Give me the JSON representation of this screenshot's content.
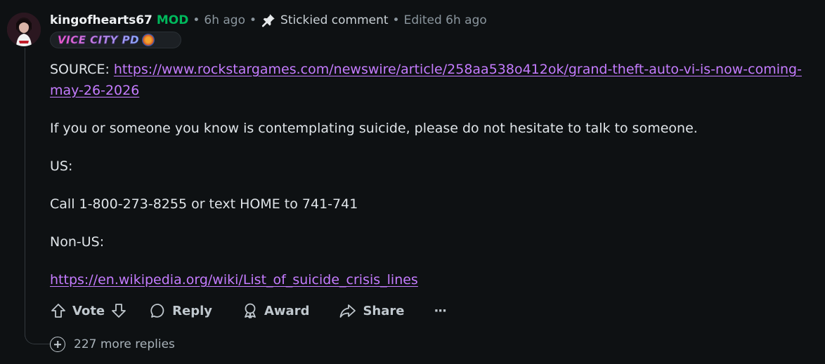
{
  "comment": {
    "username": "kingofhearts67",
    "mod_badge": "MOD",
    "separator": "•",
    "time_ago": "6h ago",
    "stickied_label": "Stickied comment",
    "edited_label": "Edited 6h ago",
    "flair_text": "VICE CITY PD",
    "source_label": "SOURCE: ",
    "source_link": "https://www.rockstargames.com/newswire/article/258aa538o412ok/grand-theft-auto-vi-is-now-coming-may-26-2026",
    "para_help": "If you or someone you know is contemplating suicide, please do not hesitate to talk to someone.",
    "para_us": "US:",
    "para_call": "Call 1-800-273-8255 or text HOME to 741-741",
    "para_nonus": "Non-US:",
    "wiki_link": "https://en.wikipedia.org/wiki/List_of_suicide_crisis_lines"
  },
  "actions": {
    "vote_label": "Vote",
    "reply_label": "Reply",
    "award_label": "Award",
    "share_label": "Share",
    "more_label": "···"
  },
  "more_replies": "227 more replies",
  "colors": {
    "background": "#0e1113",
    "mod_green": "#00b85c",
    "link_purple": "#c57cff",
    "meta_gray": "#8b969e"
  },
  "icons": [
    "pin-icon",
    "upvote-icon",
    "downvote-icon",
    "reply-icon",
    "award-icon",
    "share-icon",
    "more-icon",
    "expand-icon"
  ]
}
